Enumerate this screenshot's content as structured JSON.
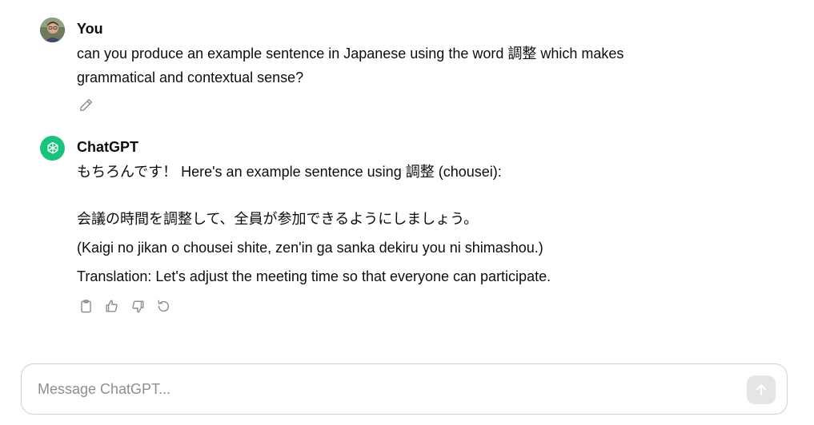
{
  "conversation": {
    "user_message": {
      "author": "You",
      "lines": [
        "can you produce an example sentence in Japanese using the word 調整 which makes",
        "grammatical and contextual sense?"
      ],
      "edit_icon": "pencil-icon"
    },
    "assistant_message": {
      "author": "ChatGPT",
      "intro": "もちろんです！ Here's an example sentence using 調整 (chousei):",
      "japanese": "会議の時間を調整して、全員が参加できるようにしましょう。",
      "romaji": "(Kaigi no jikan o chousei shite, zen'in ga sanka dekiru you ni shimashou.)",
      "translation": "Translation: Let's adjust the meeting time so that everyone can participate.",
      "actions": [
        "clipboard-icon",
        "thumbs-up-icon",
        "thumbs-down-icon",
        "regenerate-icon"
      ]
    }
  },
  "composer": {
    "placeholder": "Message ChatGPT...",
    "value": "",
    "send_icon": "arrow-up-icon"
  },
  "colors": {
    "brand_green": "#19c37d",
    "text": "#0d0d0d",
    "icon_gray": "#8e8e8e",
    "composer_border": "#d0d0d0",
    "send_bg": "#e5e5e5"
  }
}
